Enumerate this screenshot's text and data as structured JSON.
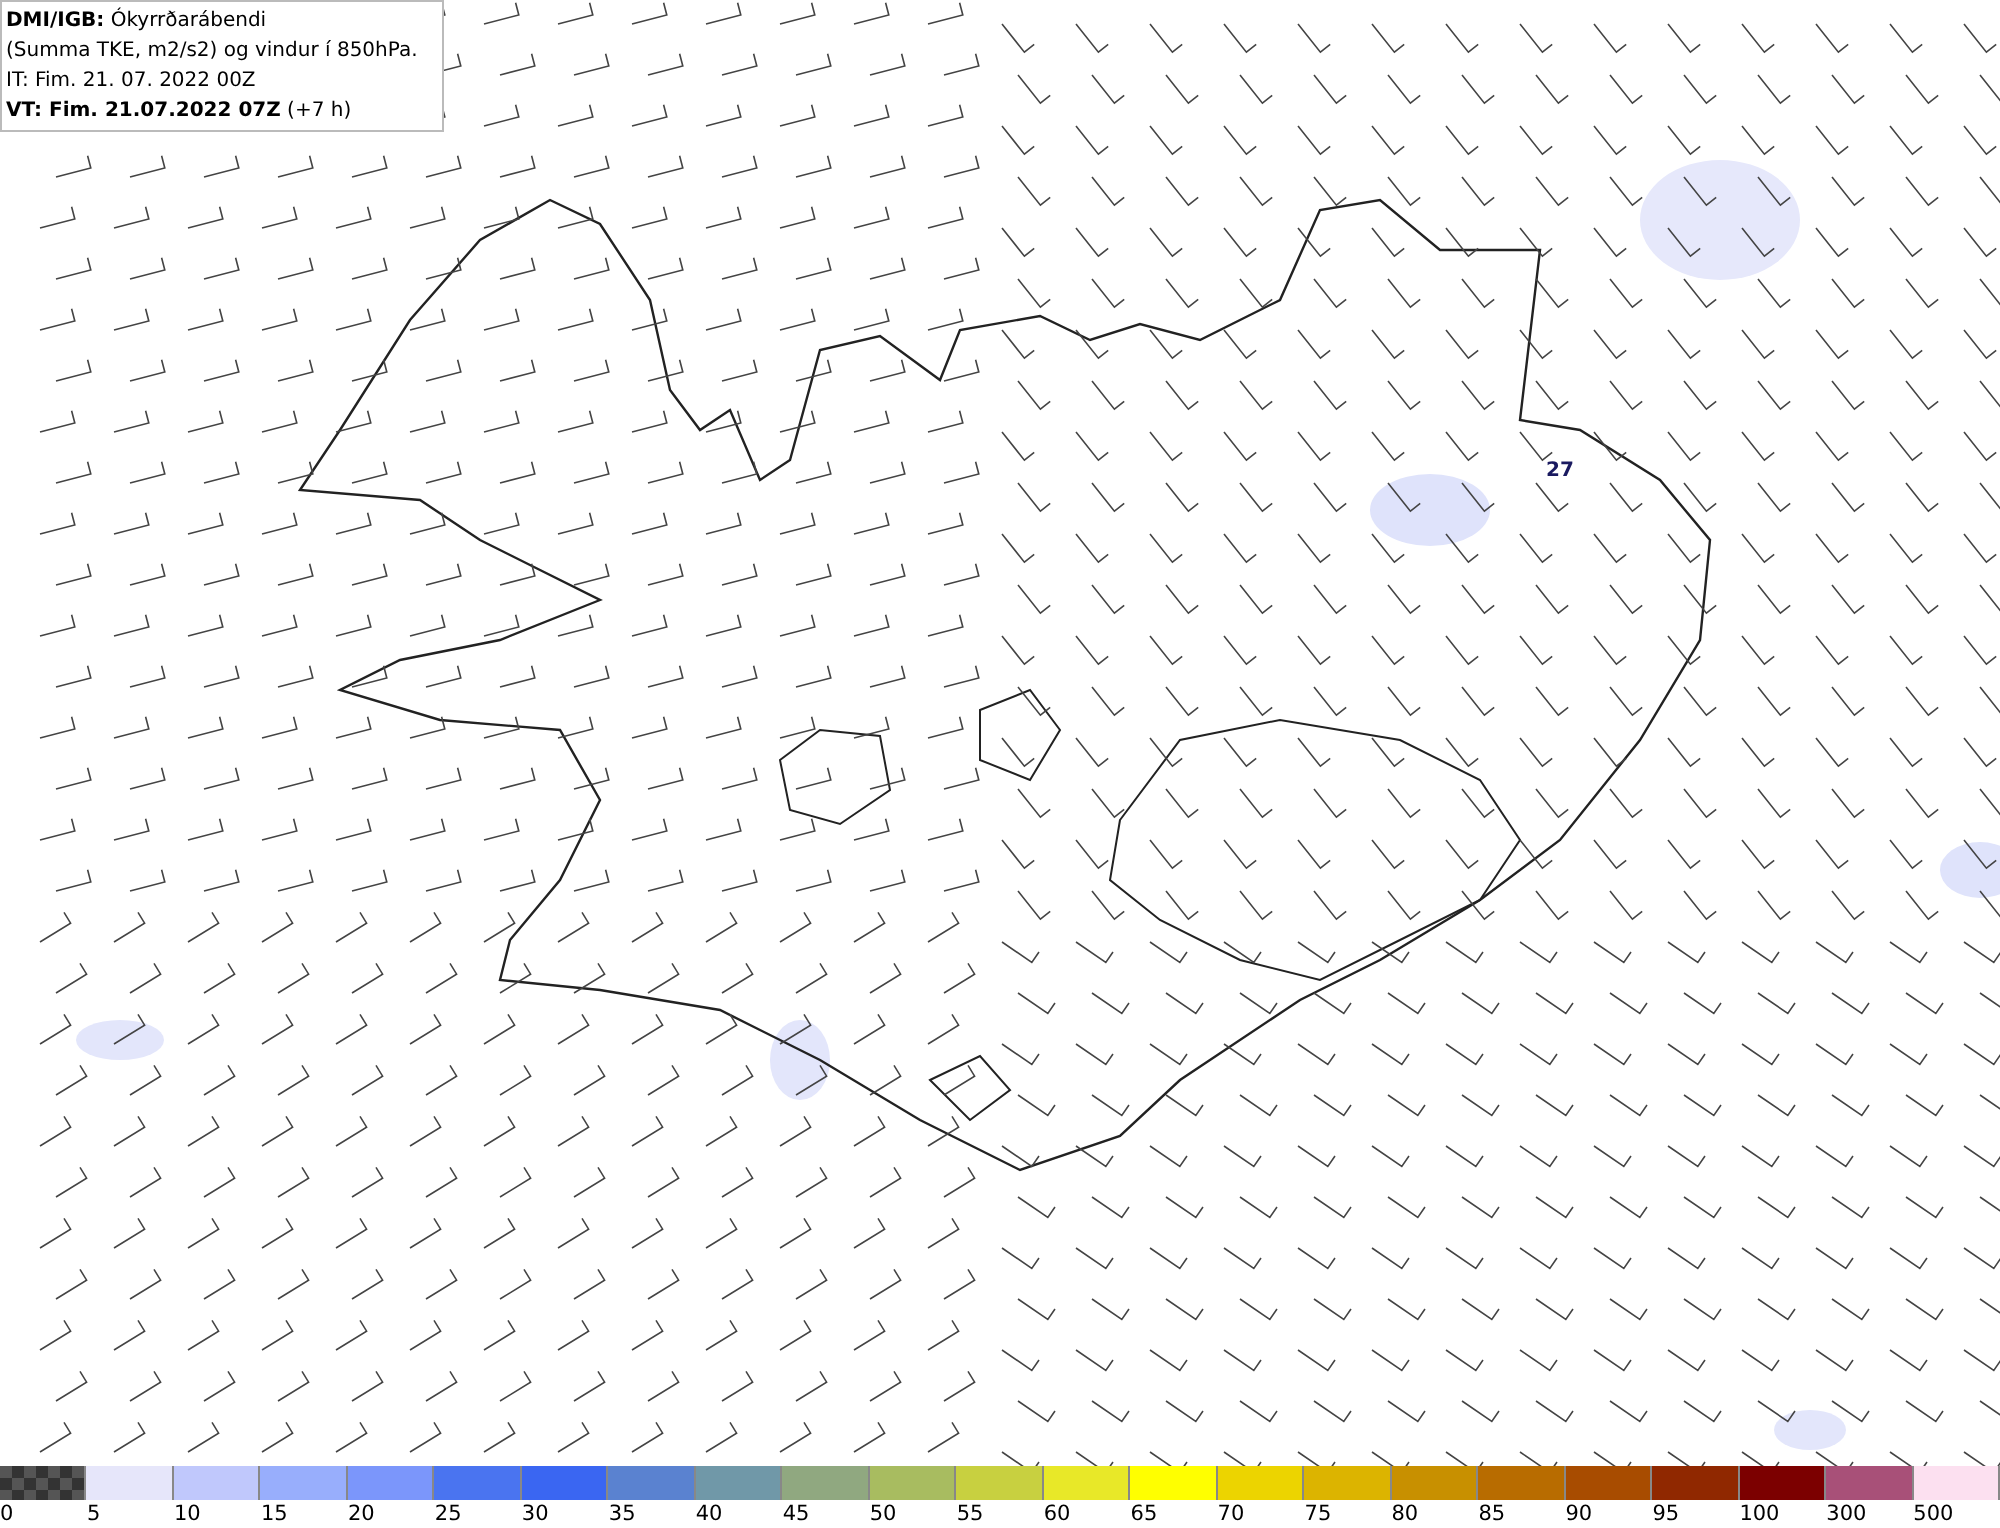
{
  "title_box": {
    "lines": [
      "**DMI/IGB:** Ókyrrðarábendi",
      "(Summa TKE, m2/s2) og vindur í 850hPa.",
      "IT: Fim. 21. 07. 2022 00Z",
      "**VT: Fim. 21.07.2022 07Z** (+7 h)"
    ]
  },
  "map": {
    "point_label": "27"
  },
  "legend": [
    {
      "label": "0",
      "kind": "checker",
      "color": "#555555"
    },
    {
      "label": "5",
      "kind": "solid",
      "color": "#e6e6fa"
    },
    {
      "label": "10",
      "kind": "solid",
      "color": "#c0c8fc"
    },
    {
      "label": "15",
      "kind": "solid",
      "color": "#98aefc"
    },
    {
      "label": "20",
      "kind": "solid",
      "color": "#7b96fb"
    },
    {
      "label": "25",
      "kind": "solid",
      "color": "#4a74f0"
    },
    {
      "label": "30",
      "kind": "solid",
      "color": "#3a66f2"
    },
    {
      "label": "35",
      "kind": "solid",
      "color": "#5a82d0"
    },
    {
      "label": "40",
      "kind": "solid",
      "color": "#7098a8"
    },
    {
      "label": "45",
      "kind": "solid",
      "color": "#90a880"
    },
    {
      "label": "50",
      "kind": "solid",
      "color": "#a8bc60"
    },
    {
      "label": "55",
      "kind": "solid",
      "color": "#c8d040"
    },
    {
      "label": "60",
      "kind": "solid",
      "color": "#e8e828"
    },
    {
      "label": "65",
      "kind": "solid",
      "color": "#ffff00"
    },
    {
      "label": "70",
      "kind": "solid",
      "color": "#ecd400"
    },
    {
      "label": "75",
      "kind": "solid",
      "color": "#dcb400"
    },
    {
      "label": "80",
      "kind": "solid",
      "color": "#c89000"
    },
    {
      "label": "85",
      "kind": "solid",
      "color": "#b86c00"
    },
    {
      "label": "90",
      "kind": "solid",
      "color": "#a84c00"
    },
    {
      "label": "95",
      "kind": "solid",
      "color": "#902800"
    },
    {
      "label": "100",
      "kind": "solid",
      "color": "#7c0000"
    },
    {
      "label": "300",
      "kind": "solid",
      "color": "#a85078"
    },
    {
      "label": "500",
      "kind": "solid",
      "color": "#fce0f0"
    }
  ]
}
